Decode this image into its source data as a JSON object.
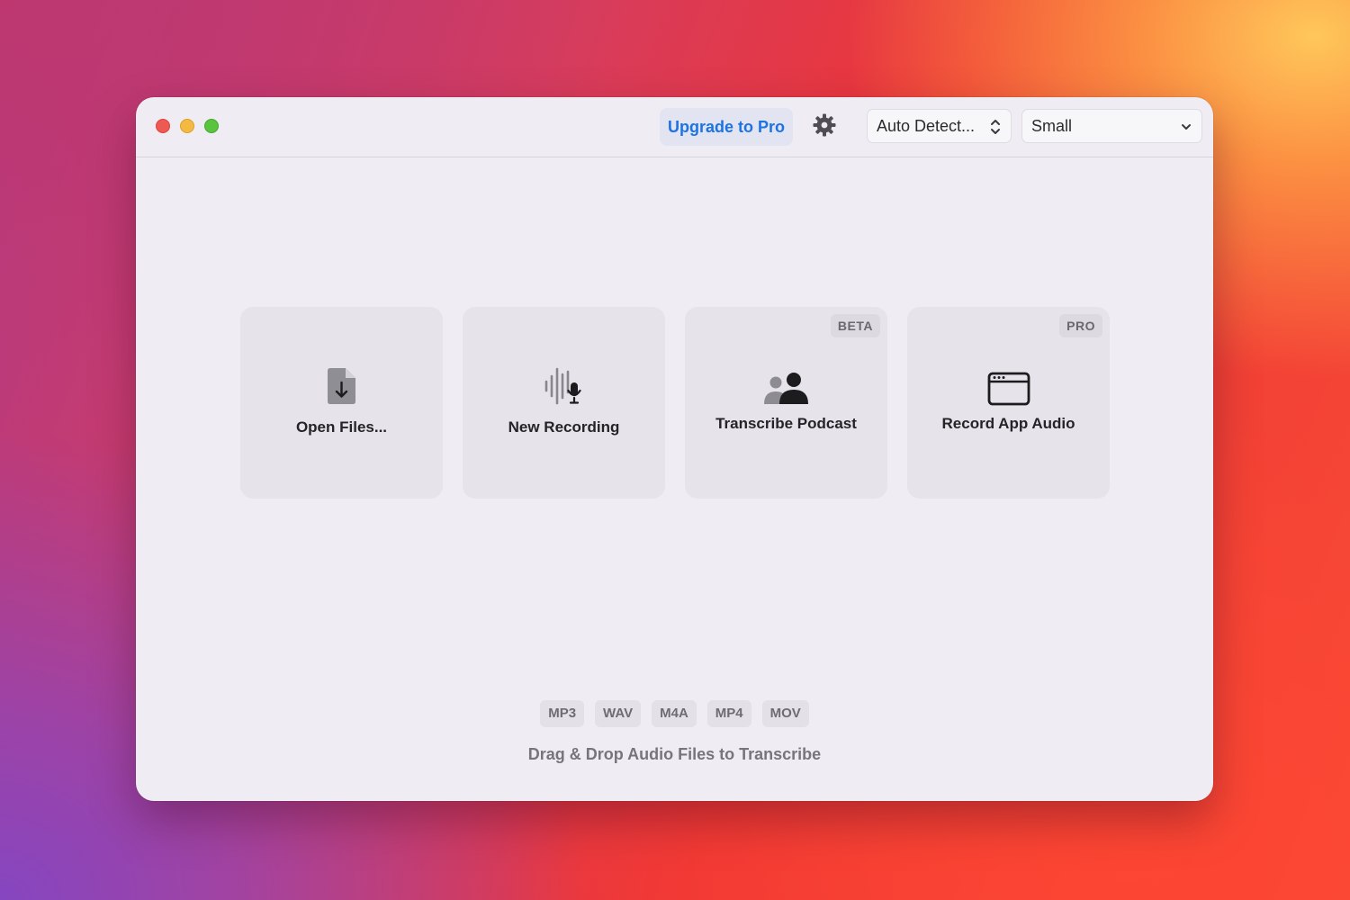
{
  "toolbar": {
    "upgrade_label": "Upgrade to Pro",
    "settings_icon": "gear-icon",
    "language_select": "Auto Detect...",
    "model_select": "Small"
  },
  "actions": [
    {
      "label": "Open Files...",
      "icon": "document-download-icon"
    },
    {
      "label": "New Recording",
      "icon": "waveform-mic-icon"
    },
    {
      "label": "Transcribe Podcast",
      "icon": "people-icon",
      "badge": "BETA"
    },
    {
      "label": "Record App Audio",
      "icon": "app-window-icon",
      "badge": "PRO"
    }
  ],
  "formats": [
    "MP3",
    "WAV",
    "M4A",
    "MP4",
    "MOV"
  ],
  "drop_hint": "Drag & Drop Audio Files to Transcribe",
  "colors": {
    "accent": "#1c73e3",
    "window_bg": "#efedf3",
    "card_bg": "#e6e4ea",
    "close": "#ee5a52",
    "minimize": "#f4b941",
    "maximize": "#5ac33f"
  }
}
